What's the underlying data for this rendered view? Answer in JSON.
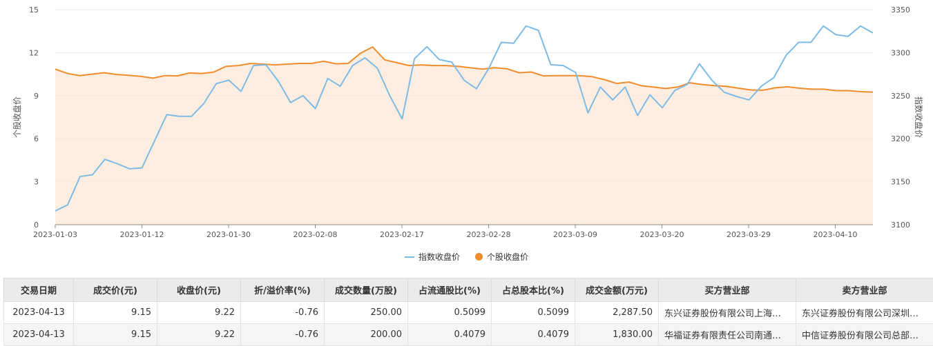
{
  "chart_data": {
    "type": "line",
    "x_tick_labels": [
      "2023-01-03",
      "2023-01-12",
      "2023-01-30",
      "2023-02-08",
      "2023-02-17",
      "2023-02-28",
      "2023-03-09",
      "2023-03-20",
      "2023-03-29",
      "2023-04-10"
    ],
    "y_left": {
      "label": "个股收盘价",
      "range": [
        0,
        15
      ],
      "ticks": [
        "0",
        "3",
        "6",
        "9",
        "12",
        "15"
      ]
    },
    "y_right": {
      "label": "指数收盘价",
      "range": [
        3100,
        3350
      ],
      "ticks": [
        "3100",
        "3150",
        "3200",
        "3250",
        "3300",
        "3350"
      ]
    },
    "grid": true,
    "legend_position": "bottom-center",
    "series": [
      {
        "name": "指数收盘价",
        "axis": "right",
        "color": "#7cbbe6",
        "values": [
          3116,
          3123,
          3156,
          3158,
          3176,
          3171,
          3165,
          3166,
          3197,
          3228,
          3226,
          3226,
          3241,
          3264,
          3268,
          3255,
          3285,
          3286,
          3267,
          3242,
          3250,
          3235,
          3270,
          3261,
          3285,
          3294,
          3282,
          3250,
          3223,
          3293,
          3307,
          3292,
          3289,
          3268,
          3258,
          3282,
          3312,
          3311,
          3331,
          3326,
          3286,
          3285,
          3277,
          3230,
          3260,
          3245,
          3260,
          3227,
          3251,
          3236,
          3256,
          3263,
          3287,
          3268,
          3254,
          3249,
          3245,
          3261,
          3271,
          3297,
          3312,
          3312,
          3331,
          3321,
          3319,
          3331,
          3323
        ]
      },
      {
        "name": "个股收盘价",
        "axis": "left",
        "color": "#f08c2b",
        "values": [
          10.85,
          10.55,
          10.4,
          10.5,
          10.6,
          10.48,
          10.42,
          10.35,
          10.22,
          10.4,
          10.38,
          10.58,
          10.55,
          10.65,
          11.05,
          11.1,
          11.25,
          11.2,
          11.15,
          11.2,
          11.25,
          11.25,
          11.4,
          11.22,
          11.25,
          11.95,
          12.4,
          11.5,
          11.3,
          11.1,
          11.15,
          11.1,
          11.1,
          11.05,
          10.95,
          10.85,
          10.95,
          10.88,
          10.6,
          10.65,
          10.38,
          10.4,
          10.4,
          10.4,
          10.32,
          10.12,
          9.85,
          9.95,
          9.7,
          9.6,
          9.5,
          9.6,
          9.9,
          9.78,
          9.7,
          9.65,
          9.52,
          9.4,
          9.38,
          9.55,
          9.62,
          9.52,
          9.45,
          9.45,
          9.35,
          9.35,
          9.28,
          9.25
        ]
      }
    ]
  },
  "legend": {
    "index_label": "指数收盘价",
    "stock_label": "个股收盘价"
  },
  "table": {
    "headers": [
      "交易日期",
      "成交价(元)",
      "收盘价(元)",
      "折/溢价率(%)",
      "成交数量(万股)",
      "占流通股比(%)",
      "占总股本比(%)",
      "成交金额(万元)",
      "买方营业部",
      "卖方营业部"
    ],
    "rows": [
      [
        "2023-04-13",
        "9.15",
        "9.22",
        "-0.76",
        "250.00",
        "0.5099",
        "0.5099",
        "2,287.50",
        "东兴证券股份有限公司上海…",
        "东兴证券股份有限公司深圳…"
      ],
      [
        "2023-04-13",
        "9.15",
        "9.22",
        "-0.76",
        "200.00",
        "0.4079",
        "0.4079",
        "1,830.00",
        "华福证券有限责任公司南通…",
        "中信证券股份有限公司总部…"
      ]
    ]
  }
}
